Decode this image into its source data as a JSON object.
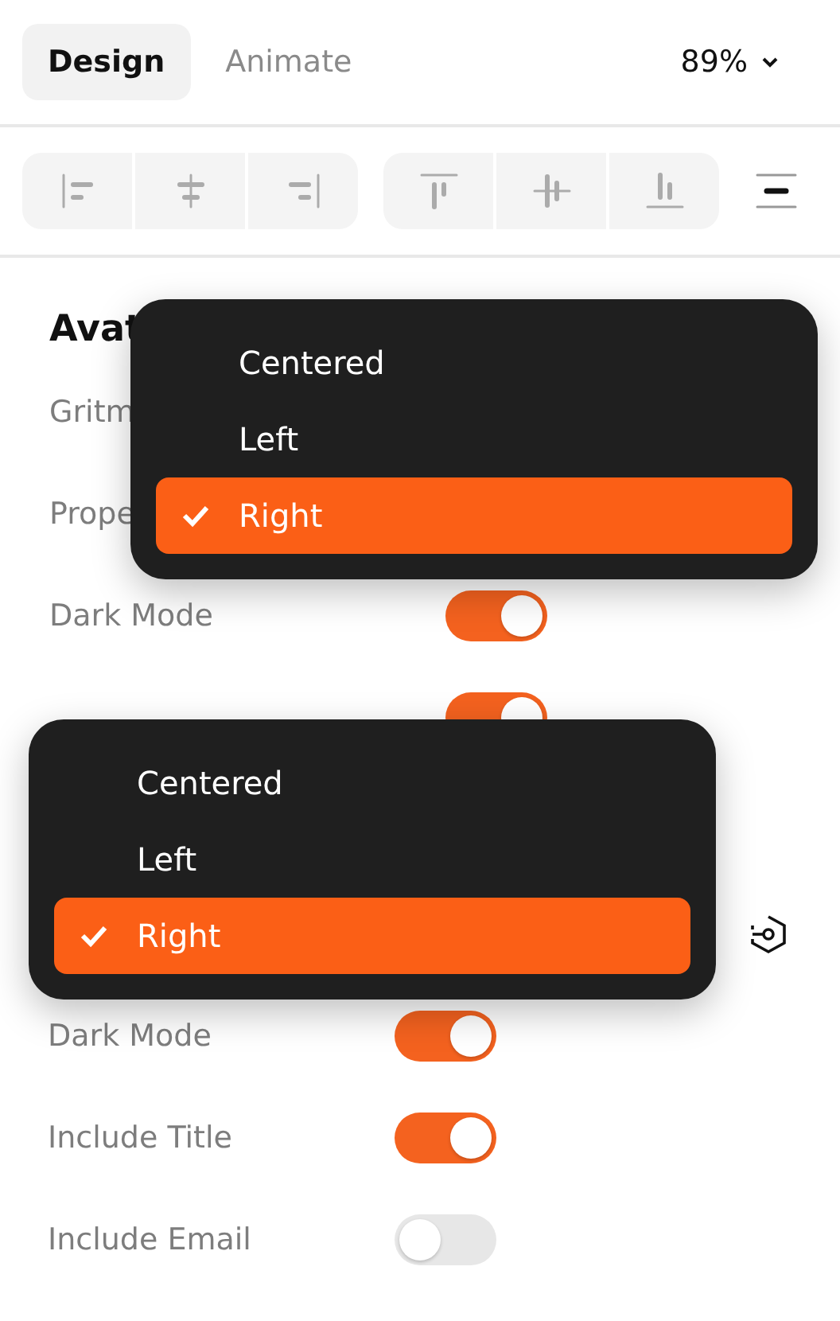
{
  "tabs": [
    {
      "label": "Design",
      "selected": true
    },
    {
      "label": "Animate",
      "selected": false
    }
  ],
  "zoom": "89%",
  "sections": [
    {
      "title": "Avat",
      "rows": [
        {
          "kind": "text",
          "label": "Gritm"
        },
        {
          "kind": "text",
          "label": "Prope"
        },
        {
          "kind": "toggle",
          "label": "Dark Mode",
          "on": true
        },
        {
          "kind": "toggle",
          "on": true
        }
      ]
    },
    {
      "rows": [
        {
          "kind": "icon"
        },
        {
          "kind": "toggle",
          "label": "Dark Mode",
          "on": true
        },
        {
          "kind": "toggle",
          "label": "Include Title",
          "on": true
        },
        {
          "kind": "toggle",
          "label": "Include Email",
          "on": false
        }
      ]
    }
  ],
  "menus": [
    {
      "items": [
        {
          "label": "Centered",
          "selected": false
        },
        {
          "label": "Left",
          "selected": false
        },
        {
          "label": "Right",
          "selected": true
        }
      ]
    },
    {
      "items": [
        {
          "label": "Centered",
          "selected": false
        },
        {
          "label": "Left",
          "selected": false
        },
        {
          "label": "Right",
          "selected": true
        }
      ]
    }
  ]
}
